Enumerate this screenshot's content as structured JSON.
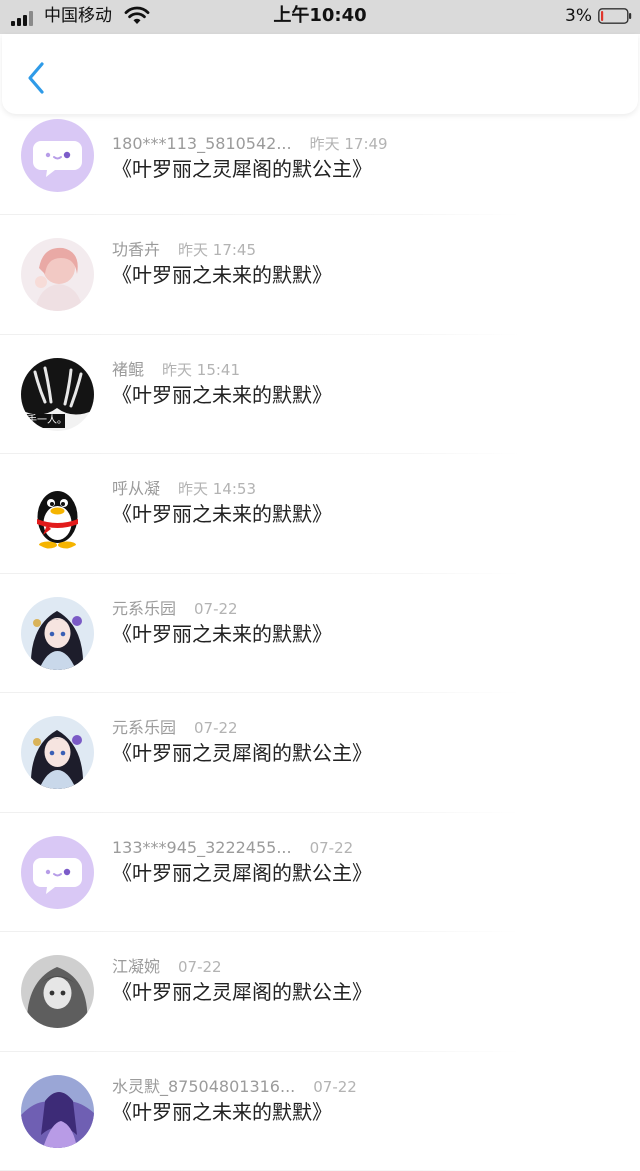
{
  "status_bar": {
    "carrier": "中国移动",
    "time": "上午10:40",
    "battery": "3%"
  },
  "colors": {
    "accent": "#2f9be8",
    "placeholder_avatar": "#d9c8f5",
    "battery_low": "#e0352b"
  },
  "header": {
    "back_icon": "chevron-left-icon"
  },
  "messages": [
    {
      "name": "180***113_5810542...",
      "time": "昨天 17:49",
      "title": "《叶罗丽之灵犀阁的默公主》",
      "avatar": "chat-bubble-placeholder"
    },
    {
      "name": "功香卉",
      "time": "昨天 17:45",
      "title": "《叶罗丽之未来的默默》",
      "avatar": "user-photo"
    },
    {
      "name": "褚鲲",
      "time": "昨天 15:41",
      "title": "《叶罗丽之未来的默默》",
      "avatar": "user-photo",
      "avatar_caption": "手一人。"
    },
    {
      "name": "呼从凝",
      "time": "昨天 14:53",
      "title": "《叶罗丽之未来的默默》",
      "avatar": "penguin"
    },
    {
      "name": "元系乐园",
      "time": "07-22",
      "title": "《叶罗丽之未来的默默》",
      "avatar": "user-photo"
    },
    {
      "name": "元系乐园",
      "time": "07-22",
      "title": "《叶罗丽之灵犀阁的默公主》",
      "avatar": "user-photo"
    },
    {
      "name": "133***945_3222455...",
      "time": "07-22",
      "title": "《叶罗丽之灵犀阁的默公主》",
      "avatar": "chat-bubble-placeholder"
    },
    {
      "name": "江凝婉",
      "time": "07-22",
      "title": "《叶罗丽之灵犀阁的默公主》",
      "avatar": "user-photo"
    },
    {
      "name": "水灵默_87504801316...",
      "time": "07-22",
      "title": "《叶罗丽之未来的默默》",
      "avatar": "user-photo"
    }
  ]
}
